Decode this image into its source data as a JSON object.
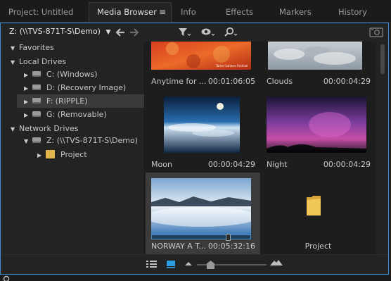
{
  "tabs": [
    {
      "label": "Project: Untitled",
      "active": false
    },
    {
      "label": "Media Browser",
      "active": true
    },
    {
      "label": "Info",
      "active": false
    },
    {
      "label": "Effects",
      "active": false
    },
    {
      "label": "Markers",
      "active": false
    },
    {
      "label": "History",
      "active": false
    }
  ],
  "tab_menu_glyph": "≡",
  "toolbar": {
    "path": "Z: (\\\\TVS-871T-S\\Demo)",
    "path_arrow": "▼",
    "back_icon": "arrow-left",
    "forward_icon": "arrow-right",
    "filter_icon": "funnel",
    "view_icon": "eye",
    "search_icon": "magnifier",
    "ingest_icon": "camera"
  },
  "tree": {
    "favorites": "Favorites",
    "local_drives": "Local Drives",
    "drives": [
      "C: (Windows)",
      "D: (Recovery Image)",
      "F: (RIPPLE)",
      "G: (Removable)"
    ],
    "network_drives": "Network Drives",
    "network_drive": "Z: (\\\\TVS-871T-S\\Demo)",
    "project_folder": "Project"
  },
  "clips": [
    {
      "name": "Anytime for ...",
      "duration": "00:01:06:05",
      "thumb_caption": "Tamer Lantern Festival"
    },
    {
      "name": "Clouds",
      "duration": "00:00:04:29"
    },
    {
      "name": "Moon",
      "duration": "00:00:04:29"
    },
    {
      "name": "Night",
      "duration": "00:00:04:29"
    },
    {
      "name": "NORWAY A T...",
      "duration": "00:05:32:16",
      "playhead_fraction": 0.78
    },
    {
      "name": "Project",
      "type": "folder"
    }
  ],
  "bottom": {
    "list_view_icon": "list-view",
    "icon_view_icon": "icon-view",
    "zoom_small_icon": "small-mountain",
    "zoom_large_icon": "large-mountain",
    "zoom_level_fraction": 0.16
  },
  "colors": {
    "accent": "#3d8fd4",
    "folder": "#e3b64c",
    "icon_view_active": "#2d9fe0"
  }
}
